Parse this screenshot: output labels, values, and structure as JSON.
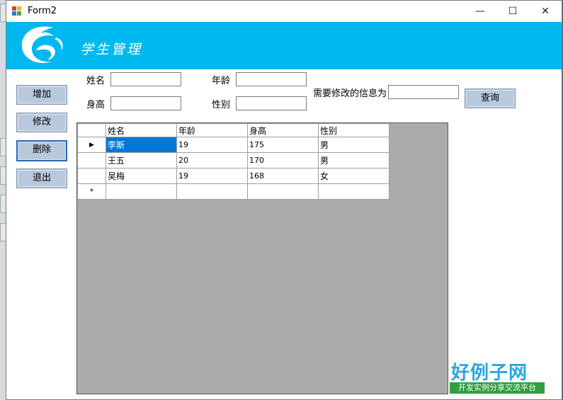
{
  "window": {
    "title": "Form2",
    "minimize_glyph": "—",
    "maximize_glyph": "☐",
    "close_glyph": "✕"
  },
  "banner": {
    "title": "学生管理"
  },
  "form": {
    "name_label": "姓名",
    "age_label": "年龄",
    "height_label": "身高",
    "gender_label": "性别",
    "modify_info_label": "需要修改的信息为",
    "name_value": "",
    "age_value": "",
    "height_value": "",
    "gender_value": "",
    "modify_info_value": ""
  },
  "buttons": {
    "add": "增加",
    "modify": "修改",
    "delete": "删除",
    "exit": "退出",
    "query": "查询"
  },
  "grid": {
    "columns": [
      "姓名",
      "年龄",
      "身高",
      "性别"
    ],
    "rows": [
      [
        "李斯",
        "19",
        "175",
        "男"
      ],
      [
        "王五",
        "20",
        "170",
        "男"
      ],
      [
        "吴梅",
        "19",
        "168",
        "女"
      ]
    ],
    "current_row_marker": "▶",
    "new_row_marker": "*"
  },
  "watermark": {
    "brand": "好例子网",
    "tagline": "开发实例分享交流平台"
  },
  "colors": {
    "banner": "#00b8f0",
    "button": "#b9c9dd",
    "selection": "#0078d7",
    "grid_background": "#ababab"
  }
}
